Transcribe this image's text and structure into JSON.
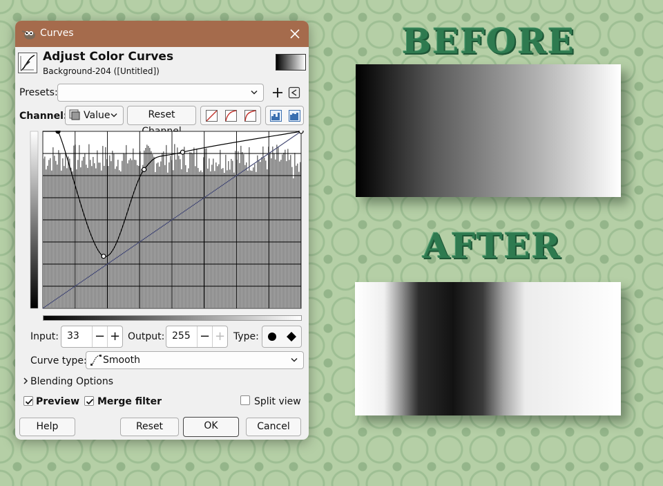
{
  "canvas": {
    "before_label": "BEFORE",
    "after_label": "AFTER"
  },
  "dialog": {
    "window_title": "Curves",
    "heading": "Adjust Color Curves",
    "subheading": "Background-204 ([Untitled])",
    "presets_label": "Presets:",
    "presets_value": "",
    "channel_label": "Channel:",
    "channel_value": "Value",
    "reset_channel_label": "Reset Channel",
    "input_label": "Input:",
    "input_value": "33",
    "output_label": "Output:",
    "output_value": "255",
    "type_label": "Type:",
    "curve_type_label": "Curve type:",
    "curve_type_value": "Smooth",
    "blending_options_label": "Blending Options",
    "preview_label": "Preview",
    "preview_checked": true,
    "merge_filter_label": "Merge filter",
    "merge_filter_checked": true,
    "split_view_label": "Split view",
    "split_view_checked": false,
    "help_label": "Help",
    "reset_label": "Reset",
    "ok_label": "OK",
    "cancel_label": "Cancel"
  },
  "curve": {
    "points": [
      [
        0,
        255
      ],
      [
        15,
        255
      ],
      [
        60,
        75
      ],
      [
        100,
        200
      ],
      [
        138,
        225
      ],
      [
        255,
        255
      ]
    ],
    "input_range": [
      0,
      255
    ],
    "output_range": [
      0,
      255
    ],
    "line_color": "#4a4f78",
    "curve_color": "#000000"
  }
}
